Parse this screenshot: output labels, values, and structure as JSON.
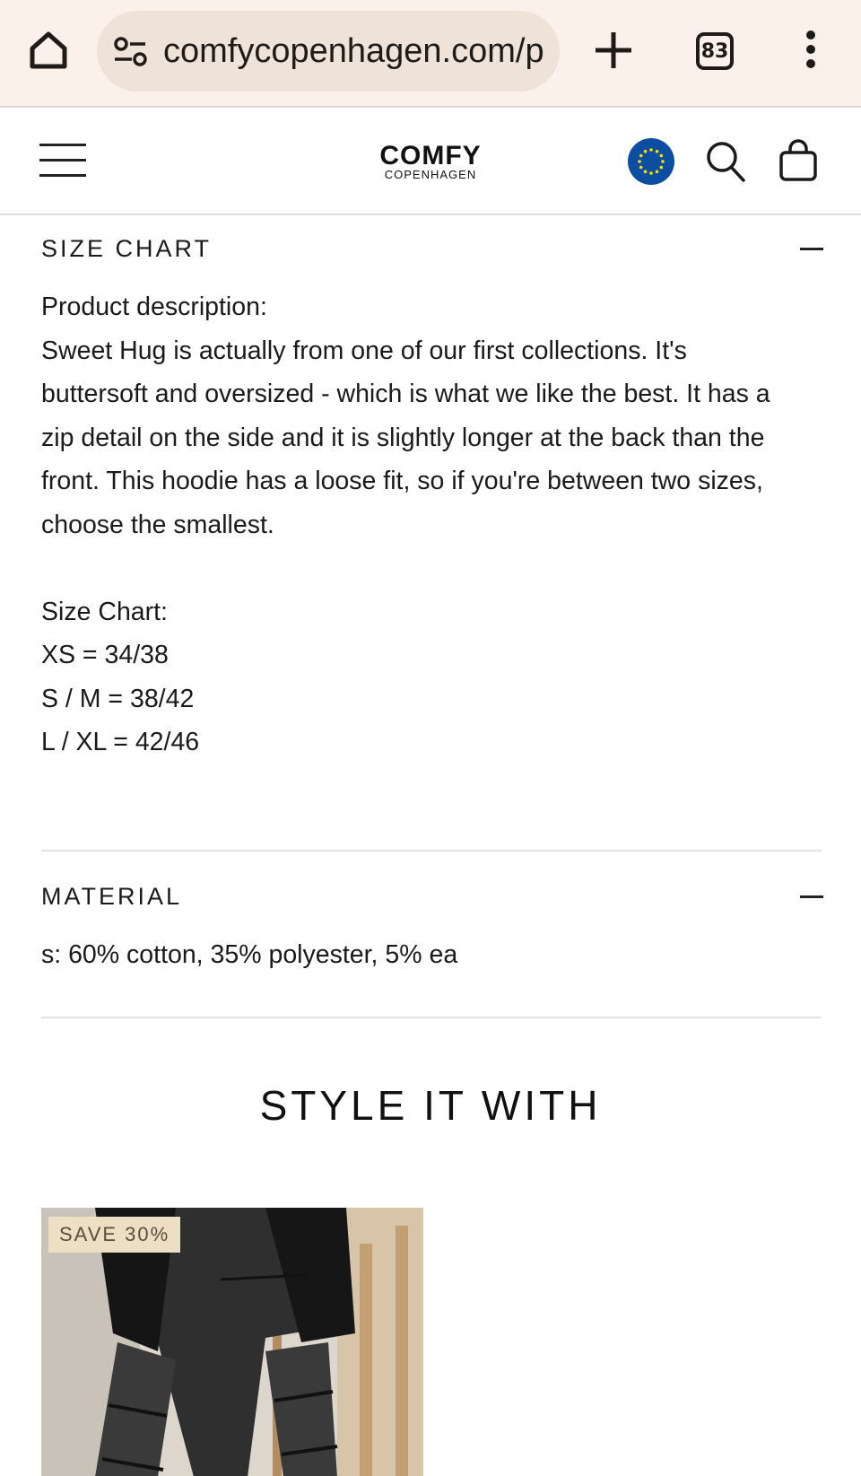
{
  "browser": {
    "url": "comfycopenhagen.com/p",
    "tab_count": "83"
  },
  "header": {
    "logo_main": "COMFY",
    "logo_sub": "COPENHAGEN"
  },
  "size_chart": {
    "title": "SIZE CHART",
    "description_label": "Product description:",
    "description": "Sweet Hug is actually from one of our first collections. It's buttersoft and oversized - which is what we like the best. It has a zip detail on the side and it is slightly longer at the back than the front. This hoodie has a loose fit, so if you're between two sizes, choose the smallest.",
    "chart_label": "Size Chart:",
    "rows": [
      "XS = 34/38",
      "S / M = 38/42",
      "L / XL = 42/46"
    ]
  },
  "material": {
    "title": "MATERIAL",
    "text": "s: 60% cotton, 35% polyester, 5% ea"
  },
  "style_it_with": {
    "heading": "STYLE IT WITH",
    "product": {
      "badge": "SAVE 30%"
    }
  },
  "colors": {
    "browser_bar": "#fbf1ea",
    "url_pill": "#efe2d8",
    "eu_blue": "#0b4ea2",
    "eu_star": "#ffdd00",
    "badge_bg": "#ecdfc4"
  },
  "icons": [
    "home-icon",
    "tune-icon",
    "plus-icon",
    "tab-switcher-icon",
    "more-vert-icon",
    "hamburger-icon",
    "eu-flag-icon",
    "search-icon",
    "bag-icon",
    "minus-icon"
  ]
}
